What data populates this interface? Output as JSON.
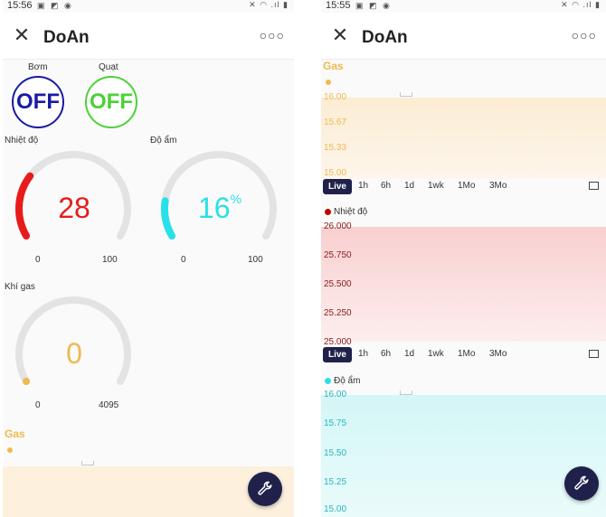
{
  "left": {
    "status": {
      "time": "15:56"
    },
    "app": {
      "title": "DoAn"
    },
    "switches": [
      {
        "label": "Bơm",
        "state": "OFF",
        "color": "#1a1aa6"
      },
      {
        "label": "Quạt",
        "state": "OFF",
        "color": "#4cd137"
      }
    ],
    "gauges": [
      {
        "label": "Nhiệt độ",
        "value": "28",
        "unit": "",
        "min": "0",
        "max": "100",
        "fraction": 0.28,
        "color": "#e81b1b"
      },
      {
        "label": "Độ ẩm",
        "value": "16",
        "unit": "%",
        "min": "0",
        "max": "100",
        "fraction": 0.16,
        "color": "#2ae0e8"
      },
      {
        "label": "Khí gas",
        "value": "0",
        "unit": "",
        "min": "0",
        "max": "4095",
        "fraction": 0.0,
        "color": "#f0b94d"
      }
    ],
    "chart_title": "Gas"
  },
  "right": {
    "status": {
      "time": "15:55"
    },
    "app": {
      "title": "DoAn"
    },
    "gas": {
      "title": "Gas",
      "yticks": [
        "16.00",
        "15.67",
        "15.33",
        "15.00"
      ],
      "color": "#f0b94d"
    },
    "time_options": [
      "Live",
      "1h",
      "6h",
      "1d",
      "1wk",
      "1Mo",
      "3Mo"
    ],
    "temp": {
      "legend": "Nhiệt độ",
      "yticks": [
        "26.000",
        "25.750",
        "25.500",
        "25.250",
        "25.000"
      ],
      "color": "#c00000"
    },
    "humidity": {
      "legend": "Độ ẩm",
      "yticks": [
        "16.00",
        "15.75",
        "15.50",
        "15.25",
        "15.00"
      ],
      "color": "#2ae0e8"
    }
  },
  "colors": {
    "accent": "#20214b"
  }
}
